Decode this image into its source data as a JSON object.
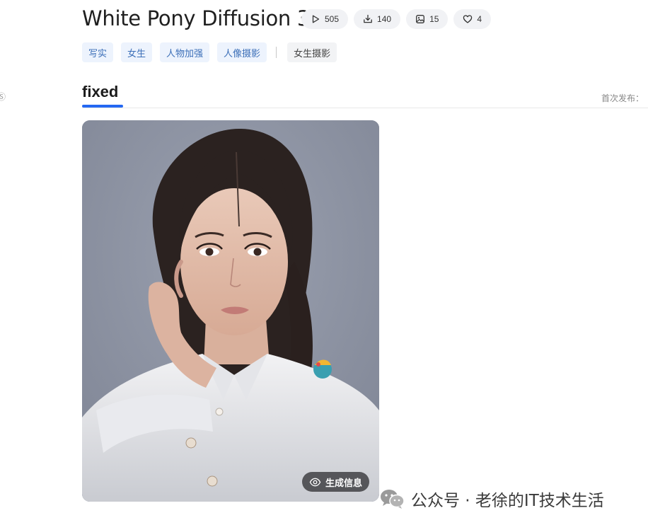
{
  "header": {
    "title": "White Pony Diffusion 3",
    "edge_char": "Ⓢ",
    "stats": [
      {
        "icon": "play-icon",
        "value": "505"
      },
      {
        "icon": "download-icon",
        "value": "140"
      },
      {
        "icon": "image-icon",
        "value": "15"
      },
      {
        "icon": "heart-icon",
        "value": "4"
      }
    ]
  },
  "tags": {
    "primary": [
      "写实",
      "女生",
      "人物加强",
      "人像摄影"
    ],
    "secondary": [
      "女生摄影"
    ]
  },
  "tabs": {
    "active": "fixed",
    "publish_label": "首次发布："
  },
  "gallery": {
    "generate_info_label": "生成信息"
  },
  "watermark": {
    "text": "公众号 · 老徐的IT技术生活"
  },
  "colors": {
    "accent": "#2468f2",
    "tag_blue_bg": "#edf3fd",
    "tag_blue_text": "#3c6fb8"
  }
}
